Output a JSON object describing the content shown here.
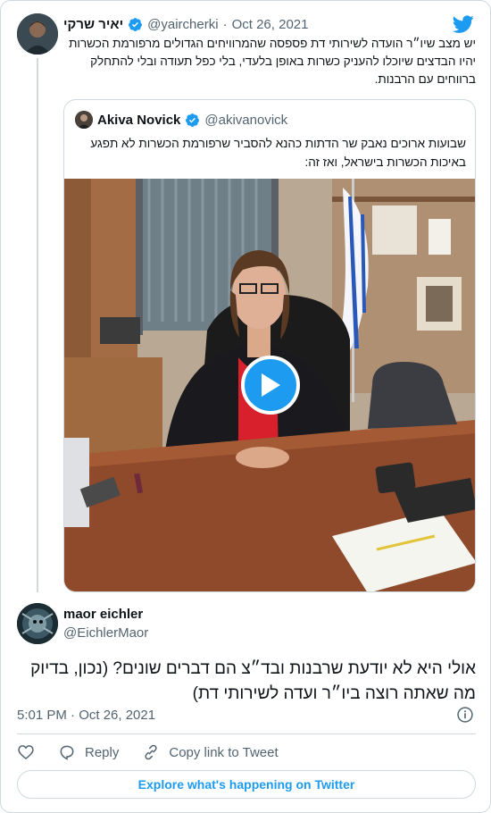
{
  "colors": {
    "accent": "#1d9bf0",
    "text": "#0f1419",
    "muted": "#536471",
    "border": "#cfd9de"
  },
  "parent_tweet": {
    "author_name": "יאיר שרקי",
    "handle": "@yaircherki",
    "separator": "·",
    "date": "Oct 26, 2021",
    "text": "יש מצב שיו״ר הועדה לשירותי דת פספסה שהמרוויחים הגדולים מרפורמת הכשרות יהיו הבדצים שיוכלו להעניק כשרות באופן בלעדי, בלי כפל תעודה ובלי להתחלק ברווחים עם הרבנות."
  },
  "quoted_tweet": {
    "author_name": "Akiva Novick",
    "handle": "@akivanovick",
    "text": "שבועות ארוכים נאבק שר הדתות כהנא להסביר שרפורמת הכשרות לא תפגע באיכות הכשרות בישראל, ואז זה:"
  },
  "reply_tweet": {
    "author_name": "maor eichler",
    "handle": "@EichlerMaor",
    "text": "אולי היא לא יודעת שרבנות ובד״צ הם דברים שונים? (נכון, בדיוק מה שאתה רוצה ביו״ר ועדה לשירותי דת)",
    "timestamp": "5:01 PM · Oct 26, 2021"
  },
  "actions": {
    "reply_label": "Reply",
    "copy_link_label": "Copy link to Tweet"
  },
  "explore_label": "Explore what's happening on Twitter",
  "icons": [
    "twitter-bird-icon",
    "verified-badge-icon",
    "play-icon",
    "info-icon",
    "heart-icon",
    "reply-icon",
    "link-icon"
  ]
}
